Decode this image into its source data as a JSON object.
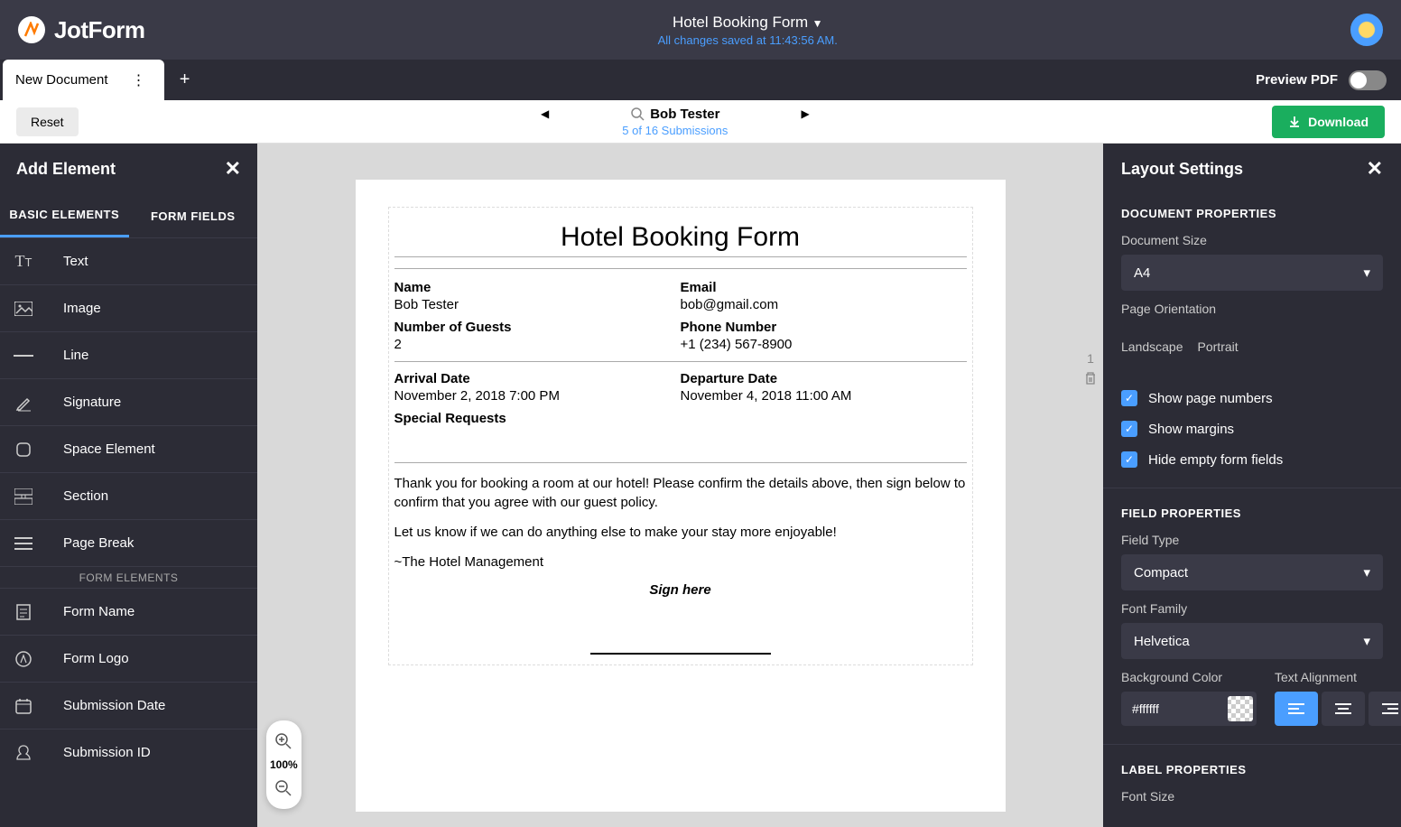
{
  "header": {
    "logo_text": "JotForm",
    "form_title": "Hotel Booking Form",
    "saved_text": "All changes saved at 11:43:56 AM."
  },
  "tabs": {
    "doc_name": "New Document",
    "preview_label": "Preview PDF"
  },
  "subbar": {
    "reset": "Reset",
    "submitter_name": "Bob Tester",
    "submission_count": "5 of 16 Submissions",
    "download": "Download"
  },
  "left_panel": {
    "title": "Add Element",
    "tabs": {
      "basic": "BASIC ELEMENTS",
      "fields": "FORM FIELDS"
    },
    "basic_items": [
      "Text",
      "Image",
      "Line",
      "Signature",
      "Space Element",
      "Section",
      "Page Break"
    ],
    "form_elements_header": "FORM ELEMENTS",
    "form_items": [
      "Form Name",
      "Form Logo",
      "Submission Date",
      "Submission ID"
    ]
  },
  "document": {
    "title": "Hotel Booking Form",
    "labels": {
      "name": "Name",
      "email": "Email",
      "guests": "Number of Guests",
      "phone": "Phone Number",
      "arrival": "Arrival Date",
      "departure": "Departure Date",
      "special": "Special Requests"
    },
    "values": {
      "name": "Bob Tester",
      "email": "bob@gmail.com",
      "guests": "2",
      "phone": "+1 (234) 567-8900",
      "arrival": "November 2, 2018 7:00 PM",
      "departure": "November 4, 2018 11:00 AM"
    },
    "msg1": "Thank you for booking a room at our hotel! Please confirm the details above, then sign below to confirm that you agree with our guest policy.",
    "msg2": "Let us know if we can do anything else to make your stay more enjoyable!",
    "msg3": "~The Hotel Management",
    "sign_here": "Sign here",
    "page_num": "1"
  },
  "zoom": {
    "pct": "100%"
  },
  "right_panel": {
    "title": "Layout Settings",
    "doc_props_title": "DOCUMENT PROPERTIES",
    "doc_size_label": "Document Size",
    "doc_size_value": "A4",
    "orientation_label": "Page Orientation",
    "orient_landscape": "Landscape",
    "orient_portrait": "Portrait",
    "checks": {
      "page_numbers": "Show page numbers",
      "margins": "Show margins",
      "hide_empty": "Hide empty form fields"
    },
    "field_props_title": "FIELD PROPERTIES",
    "field_type_label": "Field Type",
    "field_type_value": "Compact",
    "font_family_label": "Font Family",
    "font_family_value": "Helvetica",
    "bg_color_label": "Background Color",
    "bg_color_value": "#ffffff",
    "text_align_label": "Text Alignment",
    "label_props_title": "LABEL PROPERTIES",
    "font_size_label": "Font Size"
  }
}
